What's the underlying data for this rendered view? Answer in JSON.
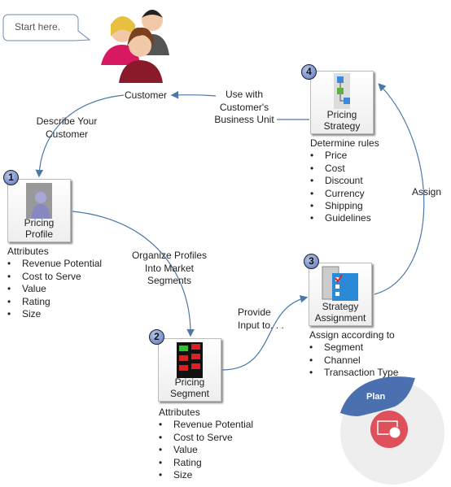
{
  "callout": "Start here.",
  "customer": "Customer",
  "edges": {
    "describe": [
      "Describe Your",
      "Customer"
    ],
    "use_with": [
      "Use with",
      "Customer's",
      "Business Unit"
    ],
    "organize": [
      "Organize Profiles",
      "Into Market",
      "Segments"
    ],
    "provide": [
      "Provide",
      "Input to. . ."
    ],
    "assign": "Assign"
  },
  "steps": [
    {
      "number": "1",
      "label": [
        "Pricing",
        "Profile"
      ],
      "heading": "Attributes",
      "items": [
        "Revenue  Potential",
        "Cost to Serve",
        "Value",
        "Rating",
        "Size"
      ]
    },
    {
      "number": "2",
      "label": [
        "Pricing",
        "Segment"
      ],
      "heading": "Attributes",
      "items": [
        "Revenue  Potential",
        "Cost to Serve",
        "Value",
        "Rating",
        "Size"
      ]
    },
    {
      "number": "3",
      "label": [
        "Strategy",
        "Assignment"
      ],
      "heading": "Assign according to",
      "items": [
        "Segment",
        "Channel",
        "Transaction Type"
      ]
    },
    {
      "number": "4",
      "label": [
        "Pricing",
        "Strategy"
      ],
      "heading": "Determine rules",
      "items": [
        "Price",
        "Cost",
        "Discount",
        "Currency",
        "Shipping",
        "Guidelines"
      ]
    }
  ],
  "plan_badge": "Plan",
  "colors": {
    "arrow": "#4a78a8",
    "plan_blue": "#4a70b0",
    "plan_red": "#e0505a",
    "plan_grey": "#eeeeee"
  }
}
